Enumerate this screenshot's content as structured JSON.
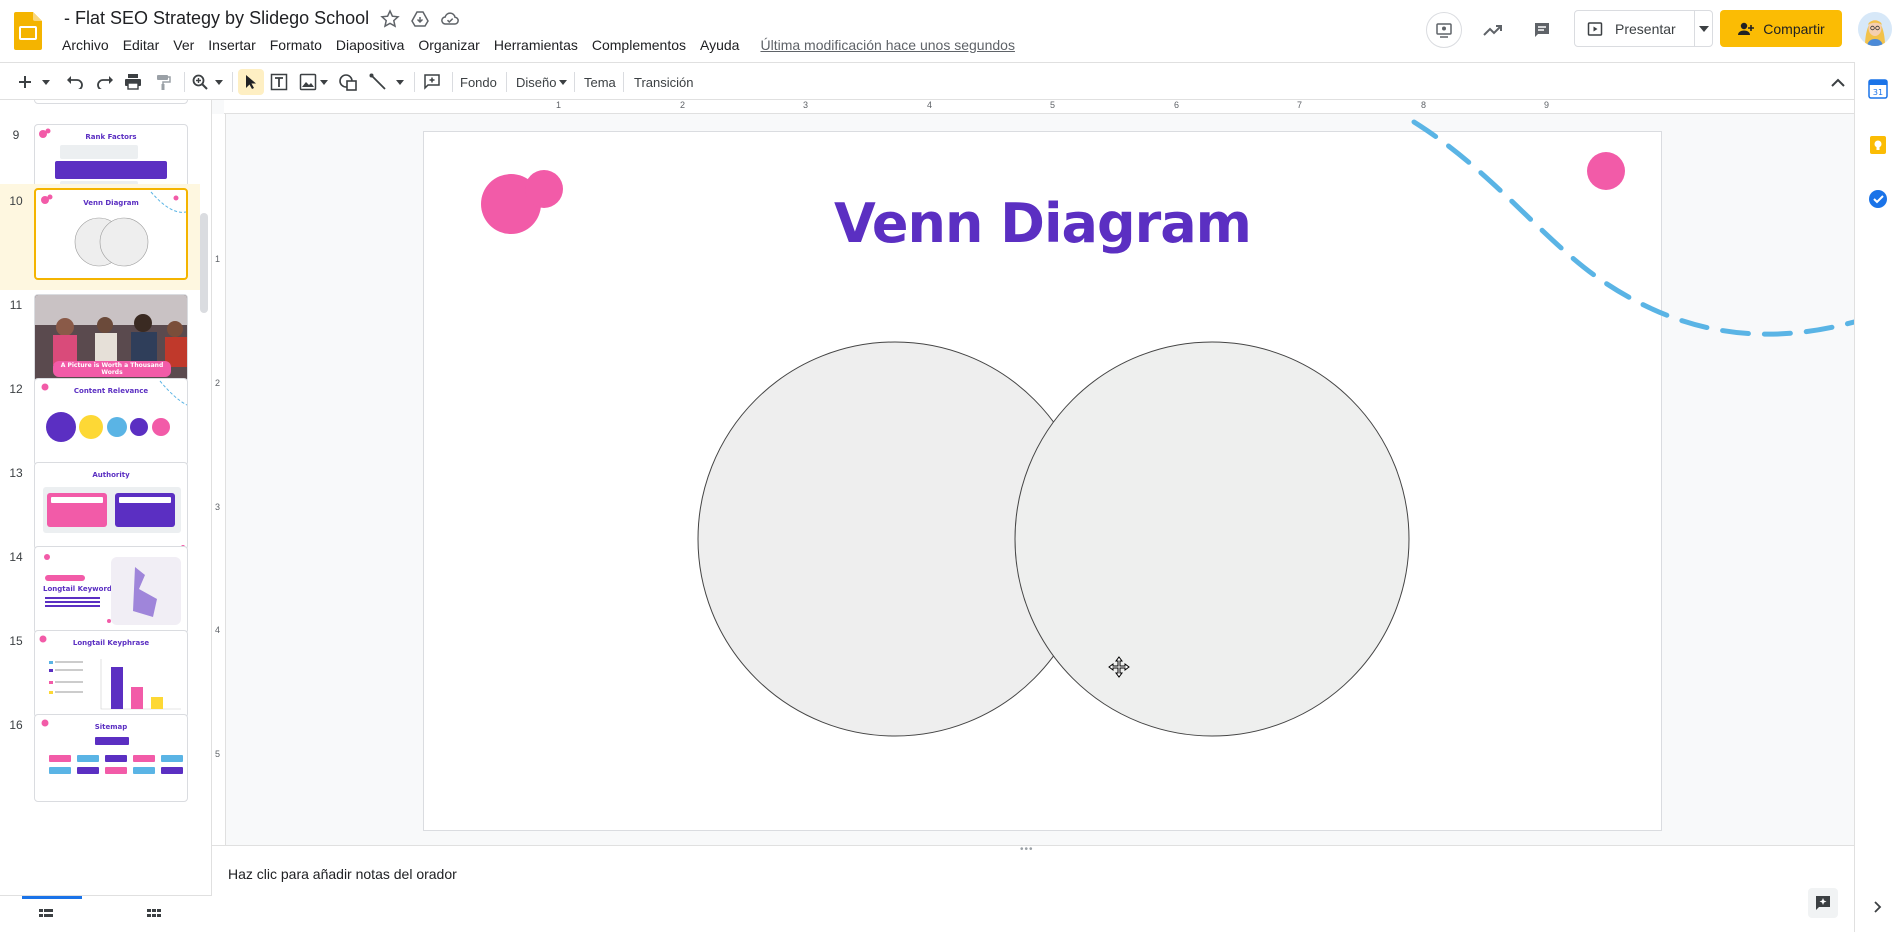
{
  "header": {
    "title": "- Flat SEO Strategy by Slidego School",
    "menu": [
      "Archivo",
      "Editar",
      "Ver",
      "Insertar",
      "Formato",
      "Diapositiva",
      "Organizar",
      "Herramientas",
      "Complementos",
      "Ayuda"
    ],
    "last_edit": "Última modificación hace unos segundos",
    "present_label": "Presentar",
    "share_label": "Compartir"
  },
  "toolbar": {
    "background_label": "Fondo",
    "layout_label": "Diseño",
    "theme_label": "Tema",
    "transition_label": "Transición"
  },
  "rulers": {
    "top": [
      "1",
      "2",
      "3",
      "4",
      "5",
      "6",
      "7",
      "8",
      "9"
    ],
    "left": [
      "1",
      "2",
      "3",
      "4",
      "5"
    ]
  },
  "filmstrip": {
    "selected": "10",
    "slides": [
      {
        "number": "9",
        "title": "Rank Factors"
      },
      {
        "number": "10",
        "title": "Venn Diagram"
      },
      {
        "number": "11",
        "title": "A Picture is Worth a Thousand Words"
      },
      {
        "number": "12",
        "title": "Content Relevance"
      },
      {
        "number": "13",
        "title": "Authority"
      },
      {
        "number": "14",
        "title": "Longtail Keyword"
      },
      {
        "number": "15",
        "title": "Longtail Keyphrase"
      },
      {
        "number": "16",
        "title": "Sitemap"
      }
    ]
  },
  "slide": {
    "title": "Venn Diagram"
  },
  "notes": {
    "placeholder": "Haz clic para añadir notas del orador"
  },
  "colors": {
    "accent_purple": "#5b2fc2",
    "accent_pink": "#f25ba8",
    "accent_blue": "#5ab4e5",
    "share_yellow": "#fbbc04",
    "circle_fill": "#eeeeee"
  }
}
